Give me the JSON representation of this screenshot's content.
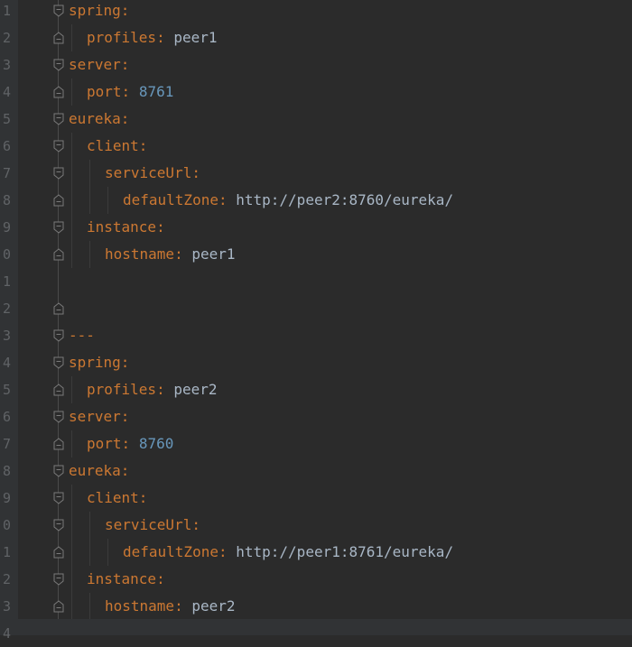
{
  "editor": {
    "lines": [
      {
        "no": "1",
        "indent": 0,
        "key": "spring",
        "value": "",
        "vtype": "",
        "fold": "open"
      },
      {
        "no": "2",
        "indent": 1,
        "key": "profiles",
        "value": "peer1",
        "vtype": "str",
        "fold": "end"
      },
      {
        "no": "3",
        "indent": 0,
        "key": "server",
        "value": "",
        "vtype": "",
        "fold": "open"
      },
      {
        "no": "4",
        "indent": 1,
        "key": "port",
        "value": "8761",
        "vtype": "num",
        "fold": "end"
      },
      {
        "no": "5",
        "indent": 0,
        "key": "eureka",
        "value": "",
        "vtype": "",
        "fold": "open"
      },
      {
        "no": "6",
        "indent": 1,
        "key": "client",
        "value": "",
        "vtype": "",
        "fold": "open"
      },
      {
        "no": "7",
        "indent": 2,
        "key": "serviceUrl",
        "value": "",
        "vtype": "",
        "fold": "open"
      },
      {
        "no": "8",
        "indent": 3,
        "key": "defaultZone",
        "value": "http://peer2:8760/eureka/",
        "vtype": "str",
        "fold": "end"
      },
      {
        "no": "9",
        "indent": 1,
        "key": "instance",
        "value": "",
        "vtype": "",
        "fold": "open"
      },
      {
        "no": "0",
        "indent": 2,
        "key": "hostname",
        "value": "peer1",
        "vtype": "str",
        "fold": "end"
      },
      {
        "no": "1",
        "indent": 0,
        "key": "",
        "value": "",
        "vtype": "",
        "fold": ""
      },
      {
        "no": "2",
        "indent": 0,
        "key": "",
        "value": "",
        "vtype": "",
        "fold": "end"
      },
      {
        "no": "3",
        "indent": 0,
        "key": "",
        "value": "",
        "vtype": "",
        "fold": "open",
        "raw": "---"
      },
      {
        "no": "4",
        "indent": 0,
        "key": "spring",
        "value": "",
        "vtype": "",
        "fold": "open"
      },
      {
        "no": "5",
        "indent": 1,
        "key": "profiles",
        "value": "peer2",
        "vtype": "str",
        "fold": "end"
      },
      {
        "no": "6",
        "indent": 0,
        "key": "server",
        "value": "",
        "vtype": "",
        "fold": "open"
      },
      {
        "no": "7",
        "indent": 1,
        "key": "port",
        "value": "8760",
        "vtype": "num",
        "fold": "end"
      },
      {
        "no": "8",
        "indent": 0,
        "key": "eureka",
        "value": "",
        "vtype": "",
        "fold": "open"
      },
      {
        "no": "9",
        "indent": 1,
        "key": "client",
        "value": "",
        "vtype": "",
        "fold": "open"
      },
      {
        "no": "0",
        "indent": 2,
        "key": "serviceUrl",
        "value": "",
        "vtype": "",
        "fold": "open"
      },
      {
        "no": "1",
        "indent": 3,
        "key": "defaultZone",
        "value": "http://peer1:8761/eureka/",
        "vtype": "str",
        "fold": "end"
      },
      {
        "no": "2",
        "indent": 1,
        "key": "instance",
        "value": "",
        "vtype": "",
        "fold": "open"
      },
      {
        "no": "3",
        "indent": 2,
        "key": "hostname",
        "value": "peer2",
        "vtype": "str",
        "fold": "end"
      },
      {
        "no": "4",
        "indent": 0,
        "key": "",
        "value": "",
        "vtype": "",
        "fold": ""
      }
    ]
  },
  "colors": {
    "background": "#2b2b2b",
    "key": "#cc7832",
    "string": "#a9b7c6",
    "number": "#6897bb",
    "line_number": "#606366"
  }
}
